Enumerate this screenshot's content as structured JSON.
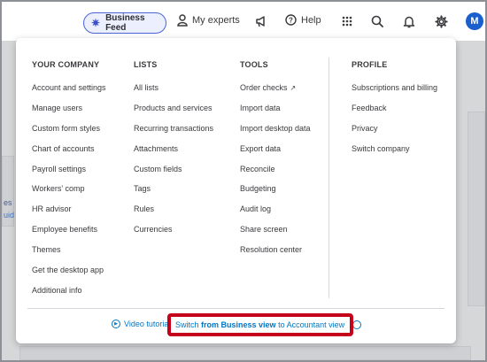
{
  "topbar": {
    "business_feed": "Business Feed",
    "my_experts": "My experts",
    "help": "Help",
    "avatar_letter": "M"
  },
  "background": {
    "left_fragment_1": "es",
    "left_fragment_2": "uid"
  },
  "menu": {
    "your_company": {
      "heading": "YOUR COMPANY",
      "items": [
        "Account and settings",
        "Manage users",
        "Custom form styles",
        "Chart of accounts",
        "Payroll settings",
        "Workers' comp",
        "HR advisor",
        "Employee benefits",
        "Themes",
        "Get the desktop app",
        "Additional info"
      ]
    },
    "lists": {
      "heading": "LISTS",
      "items": [
        "All lists",
        "Products and services",
        "Recurring transactions",
        "Attachments",
        "Custom fields",
        "Tags",
        "Rules",
        "Currencies"
      ]
    },
    "tools": {
      "heading": "TOOLS",
      "items": [
        "Order checks",
        "Import data",
        "Import desktop data",
        "Export data",
        "Reconcile",
        "Budgeting",
        "Audit log",
        "Share screen",
        "Resolution center"
      ]
    },
    "profile": {
      "heading": "PROFILE",
      "items": [
        "Subscriptions and billing",
        "Feedback",
        "Privacy",
        "Switch company"
      ]
    },
    "footer": {
      "video_tutorials": "Video tutoria",
      "switch_prefix": "Switch",
      "switch_bold": "from Business view",
      "switch_suffix": "to Accountant view"
    }
  },
  "colors": {
    "highlight_border": "#c4001a",
    "link": "#0077c5",
    "accent": "#4c63d8"
  }
}
